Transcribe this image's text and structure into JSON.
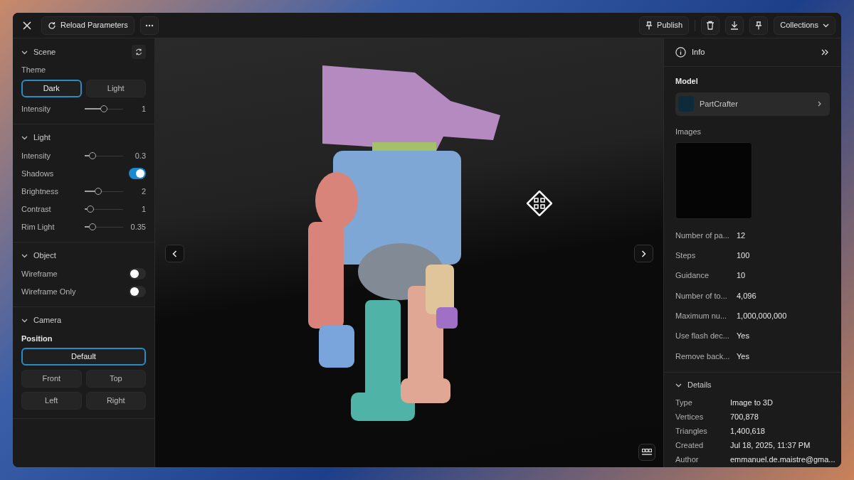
{
  "toolbar": {
    "reload_label": "Reload Parameters",
    "publish_label": "Publish",
    "collections_label": "Collections"
  },
  "left_panel": {
    "sections": [
      {
        "title": "Scene",
        "expanded": true,
        "controls": [
          {
            "kind": "segmented",
            "label": "Theme",
            "options": [
              {
                "label": "Dark",
                "selected": true
              },
              {
                "label": "Light",
                "selected": false
              }
            ]
          },
          {
            "kind": "slider",
            "label": "Intensity",
            "level": 0.5,
            "reading": "1"
          }
        ]
      },
      {
        "title": "Light",
        "expanded": true,
        "controls": [
          {
            "kind": "slider",
            "label": "Intensity",
            "level": 0.2,
            "reading": "0.3"
          },
          {
            "kind": "toggle",
            "label": "Shadows",
            "on": true
          },
          {
            "kind": "slider",
            "label": "Brightness",
            "level": 0.35,
            "reading": "2"
          },
          {
            "kind": "slider",
            "label": "Contrast",
            "level": 0.15,
            "reading": "1"
          },
          {
            "kind": "slider",
            "label": "Rim Light",
            "level": 0.2,
            "reading": "0.35"
          }
        ]
      },
      {
        "title": "Object",
        "expanded": true,
        "controls": [
          {
            "kind": "toggle",
            "label": "Wireframe",
            "on": false
          },
          {
            "kind": "toggle",
            "label": "Wireframe Only",
            "on": false
          }
        ]
      },
      {
        "title": "Camera",
        "expanded": true,
        "controls": [
          {
            "kind": "grid",
            "label": "Position",
            "options": [
              {
                "label": "Default",
                "selected": true
              },
              {
                "label": "Front",
                "selected": false
              },
              {
                "label": "Top",
                "selected": false
              },
              {
                "label": "Left",
                "selected": false
              },
              {
                "label": "Right",
                "selected": false
              }
            ]
          }
        ]
      }
    ]
  },
  "info_panel": {
    "title": "Info",
    "model_label": "Model",
    "model_name": "PartCrafter",
    "images_label": "Images",
    "parameters": [
      {
        "label": "Number of pa...",
        "value": "12"
      },
      {
        "label": "Steps",
        "value": "100"
      },
      {
        "label": "Guidance",
        "value": "10"
      },
      {
        "label": "Number of to...",
        "value": "4,096"
      },
      {
        "label": "Maximum nu...",
        "value": "1,000,000,000"
      },
      {
        "label": "Use flash dec...",
        "value": "Yes"
      },
      {
        "label": "Remove back...",
        "value": "Yes"
      }
    ],
    "details": {
      "title": "Details",
      "expanded": true,
      "rows": [
        {
          "label": "Type",
          "value": "Image to 3D"
        },
        {
          "label": "Vertices",
          "value": "700,878"
        },
        {
          "label": "Triangles",
          "value": "1,400,618"
        },
        {
          "label": "Created",
          "value": "Jul 18, 2025, 11:37 PM"
        },
        {
          "label": "Author",
          "value": "emmanuel.de.maistre@gma..."
        }
      ]
    }
  }
}
